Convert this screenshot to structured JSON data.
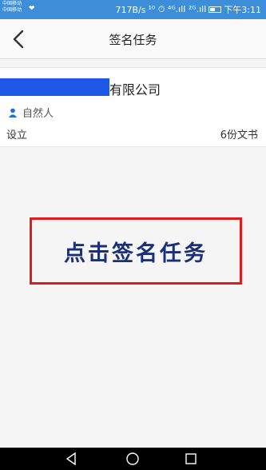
{
  "status_bar": {
    "carrier_1": "中国移动",
    "carrier_2": "中国移动",
    "speed": "717B/s",
    "signals": "¹⁰ ⏱ ⁴ᴳ.ıll ²ᴳ.ıll",
    "time": "下午3:11"
  },
  "nav": {
    "title": "签名任务",
    "back_icon": "chevron-left-icon"
  },
  "task": {
    "company_visible": "有限公司",
    "signer_type": "自然人",
    "status": "设立",
    "doc_count": "6份文书"
  },
  "annotation": {
    "text": "点击签名任务"
  },
  "colors": {
    "status_bar": "#3d8ed9",
    "accent": "#1f6fd8",
    "annotation_border": "#e21a1a",
    "annotation_text": "#1a2e7a",
    "redaction": "#1f57e6"
  }
}
